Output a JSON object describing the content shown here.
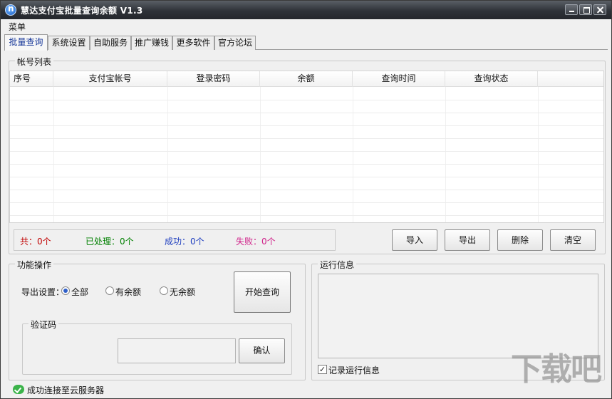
{
  "window": {
    "title": "慧达支付宝批量查询余额 V1.3"
  },
  "menu": {
    "label": "菜单"
  },
  "tabs": [
    {
      "label": "批量查询"
    },
    {
      "label": "系统设置"
    },
    {
      "label": "自助服务"
    },
    {
      "label": "推广赚钱"
    },
    {
      "label": "更多软件"
    },
    {
      "label": "官方论坛"
    }
  ],
  "account_list": {
    "title": "帐号列表",
    "columns": [
      "序号",
      "支付宝帐号",
      "登录密码",
      "余额",
      "查询时间",
      "查询状态"
    ]
  },
  "stats": {
    "total": "共：0个",
    "processed": "已处理：0个",
    "success": "成功：0个",
    "failed": "失败：0个"
  },
  "list_buttons": {
    "import": "导入",
    "export": "导出",
    "delete": "删除",
    "clear": "清空"
  },
  "operations": {
    "title": "功能操作",
    "export_label": "导出设置：",
    "options": [
      "全部",
      "有余额",
      "无余额"
    ],
    "selected_option": "全部",
    "start_button": "开始查询",
    "captcha": {
      "title": "验证码",
      "confirm_button": "确认"
    }
  },
  "run_info": {
    "title": "运行信息",
    "log_checkbox_label": "记录运行信息",
    "log_checked": true
  },
  "status": {
    "text": "成功连接至云服务器"
  },
  "watermark": {
    "text": "下载吧"
  },
  "colors": {
    "total": "#c00000",
    "processed": "#008000",
    "success": "#1f3fbf",
    "failed": "#d0238a"
  }
}
